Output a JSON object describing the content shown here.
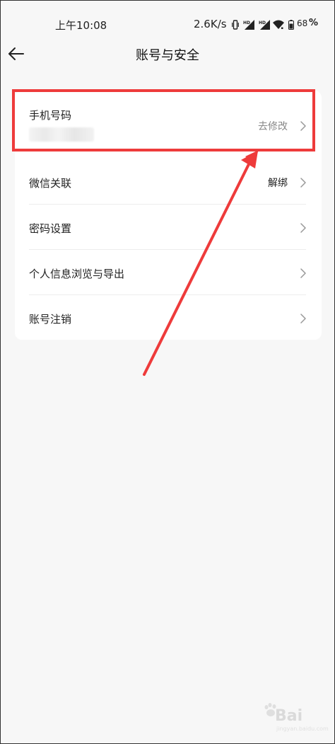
{
  "status_bar": {
    "time": "上午10:08",
    "net_speed": "2.6K/s",
    "battery_percent": "68",
    "battery_unit": "%",
    "icons": [
      "vibrate-icon",
      "hd-signal-icon",
      "hd-signal-icon",
      "wifi-icon",
      "battery-icon"
    ]
  },
  "header": {
    "title": "账号与安全",
    "back_icon": "arrow-left-icon"
  },
  "settings": {
    "items": [
      {
        "label": "手机号码",
        "value": "去修改"
      },
      {
        "label": "微信关联",
        "value": "解绑"
      },
      {
        "label": "密码设置",
        "value": ""
      },
      {
        "label": "个人信息浏览与导出",
        "value": ""
      },
      {
        "label": "账号注销",
        "value": ""
      }
    ]
  },
  "annotation": {
    "color": "#ee3b3b"
  },
  "watermark": {
    "text": "Bai",
    "sub": "jingyan.baidu.com"
  }
}
